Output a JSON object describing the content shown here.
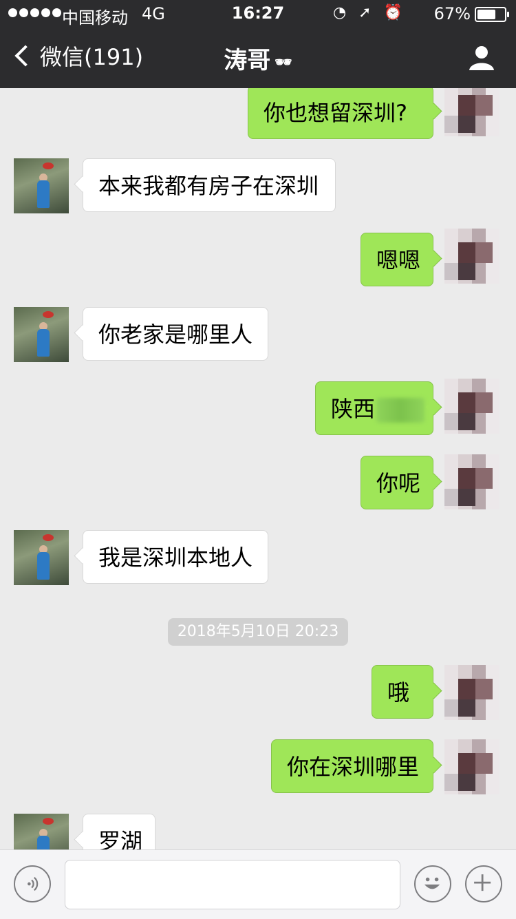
{
  "status_bar": {
    "carrier": "中国移动",
    "network": "4G",
    "time": "16:27",
    "battery": "67%",
    "battery_level": 0.67
  },
  "nav": {
    "back_label": "微信(191)",
    "title": "涛哥",
    "title_emoji": "🕶"
  },
  "messages": [
    {
      "side": "out",
      "text": "你也想留深圳?"
    },
    {
      "side": "in",
      "text": "本来我都有房子在深圳"
    },
    {
      "side": "out",
      "text": "嗯嗯"
    },
    {
      "side": "in",
      "text": "你老家是哪里人"
    },
    {
      "side": "out",
      "text": "陕西"
    },
    {
      "side": "out",
      "text": "你呢"
    },
    {
      "side": "in",
      "text": "我是深圳本地人"
    },
    {
      "side": "out",
      "text": "哦"
    },
    {
      "side": "out",
      "text": "你在深圳哪里"
    },
    {
      "side": "in",
      "text": "罗湖"
    }
  ],
  "timestamp": "2018年5月10日 20:23",
  "colors": {
    "nav_bg": "#2c2c2e",
    "chat_bg": "#ebebeb",
    "outgoing_bubble": "#9fe658",
    "incoming_bubble": "#ffffff"
  },
  "icons": {
    "voice": "voice-icon",
    "emoji": "emoji-icon",
    "plus": "plus-icon",
    "contact": "person-icon",
    "back": "chevron-left-icon"
  }
}
